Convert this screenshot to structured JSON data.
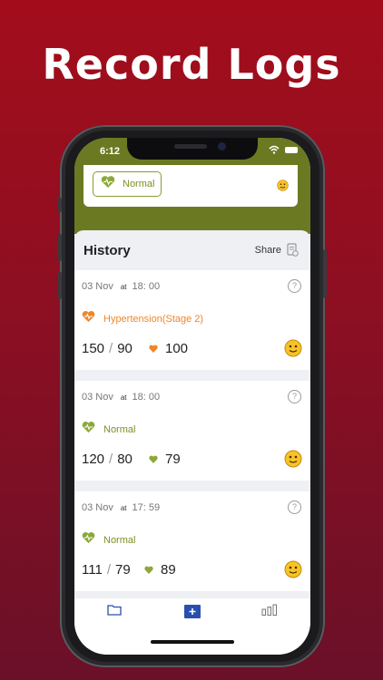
{
  "headline": "Record Logs",
  "status_bar": {
    "time": "6:12"
  },
  "top_card": {
    "status_label": "Normal"
  },
  "history": {
    "title": "History",
    "share_label": "Share",
    "entries": [
      {
        "date": "03 Nov",
        "at": "at",
        "time": "18: 00",
        "help": "?",
        "status": "Hypertension(Stage 2)",
        "status_color": "#f0862b",
        "systolic": "150",
        "slash": "/",
        "diastolic": "90",
        "pulse": "100",
        "heart_color": "#f0862b"
      },
      {
        "date": "03 Nov",
        "at": "at",
        "time": "18: 00",
        "help": "?",
        "status": "Normal",
        "status_color": "#7d8f25",
        "systolic": "120",
        "slash": "/",
        "diastolic": "80",
        "pulse": "79",
        "heart_color": "#8da83a"
      },
      {
        "date": "03 Nov",
        "at": "at",
        "time": "17: 59",
        "help": "?",
        "status": "Normal",
        "status_color": "#7d8f25",
        "systolic": "111",
        "slash": "/",
        "diastolic": "79",
        "pulse": "89",
        "heart_color": "#8da83a"
      }
    ]
  },
  "tabbar": {
    "tabs": [
      {
        "icon": "folder-icon"
      },
      {
        "icon": "add-icon"
      },
      {
        "icon": "bar-chart-icon"
      }
    ]
  },
  "colors": {
    "background": "#a30d1b",
    "header_green": "#6b7a22",
    "accent_blue": "#2a4fb0"
  }
}
